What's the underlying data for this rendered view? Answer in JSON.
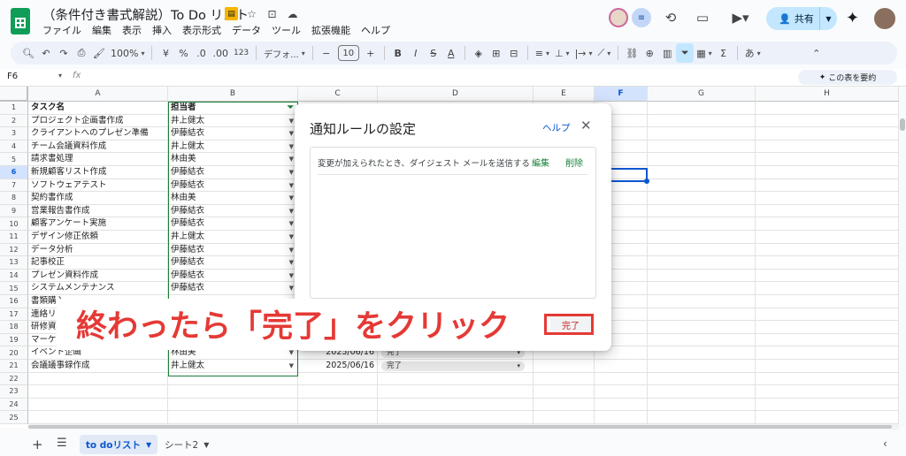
{
  "document": {
    "title": "（条件付き書式解説）To Do リスト"
  },
  "menu": [
    "ファイル",
    "編集",
    "表示",
    "挿入",
    "表示形式",
    "データ",
    "ツール",
    "拡張機能",
    "ヘルプ"
  ],
  "header_right": {
    "share_label": "共有"
  },
  "toolbar": {
    "zoom": "100%",
    "currency": "¥",
    "percent": "%",
    "dec_decrease": ".0",
    "dec_increase": ".00",
    "number_format": "123",
    "font": "デフォ...",
    "font_size": "10",
    "bold": "B",
    "italic": "I",
    "strike": "S",
    "text_color": "A",
    "ime": "あ"
  },
  "formula_bar": {
    "cell_ref": "F6",
    "fx": "fx",
    "summarize_label": "この表を要約"
  },
  "columns": [
    "A",
    "B",
    "C",
    "D",
    "E",
    "F",
    "G",
    "H"
  ],
  "rows": [
    "1",
    "2",
    "3",
    "4",
    "5",
    "6",
    "7",
    "8",
    "9",
    "10",
    "11",
    "12",
    "13",
    "14",
    "15",
    "16",
    "17",
    "18",
    "19",
    "20",
    "21",
    "22",
    "23",
    "24",
    "25"
  ],
  "table": {
    "header_a": "タスク名",
    "header_b": "担当者",
    "tasks": [
      "プロジェクト企画書作成",
      "クライアントへのプレゼン準備",
      "チーム会議資料作成",
      "請求書処理",
      "新規顧客リスト作成",
      "ソフトウェアテスト",
      "契約書作成",
      "営業報告書作成",
      "顧客アンケート実施",
      "デザイン修正依頼",
      "データ分析",
      "記事校正",
      "プレゼン資料作成",
      "システムメンテナンス",
      "書類購入",
      "連絡リス",
      "研修資料",
      "マーケテ",
      "イベント企画",
      "会議議事録作成"
    ],
    "assignees": [
      "井上健太",
      "伊藤結衣",
      "井上健太",
      "林由美",
      "伊藤結衣",
      "伊藤結衣",
      "林由美",
      "伊藤結衣",
      "伊藤結衣",
      "井上健太",
      "伊藤結衣",
      "伊藤結衣",
      "伊藤結衣",
      "伊藤結衣",
      "",
      "",
      "",
      "",
      "林由美",
      "井上健太"
    ],
    "row20_date": "2025/06/16",
    "row21_date": "2025/06/16",
    "row20_status": "完了",
    "row21_status": "完了"
  },
  "dialog": {
    "title": "通知ルールの設定",
    "help": "ヘルプ",
    "close": "✕",
    "rule_text": "変更が加えられたとき、ダイジェスト メールを送信する",
    "edit": "編集",
    "delete": "削除",
    "done": "完了"
  },
  "annotation": {
    "text": "終わったら「完了」をクリック",
    "color": "#e53935"
  },
  "sheets": {
    "active": "to doリスト",
    "other": "シート2"
  },
  "colors": {
    "sheets_green": "#0f9d58",
    "accent_blue": "#0b57d0",
    "share_bg": "#c2e7ff"
  }
}
